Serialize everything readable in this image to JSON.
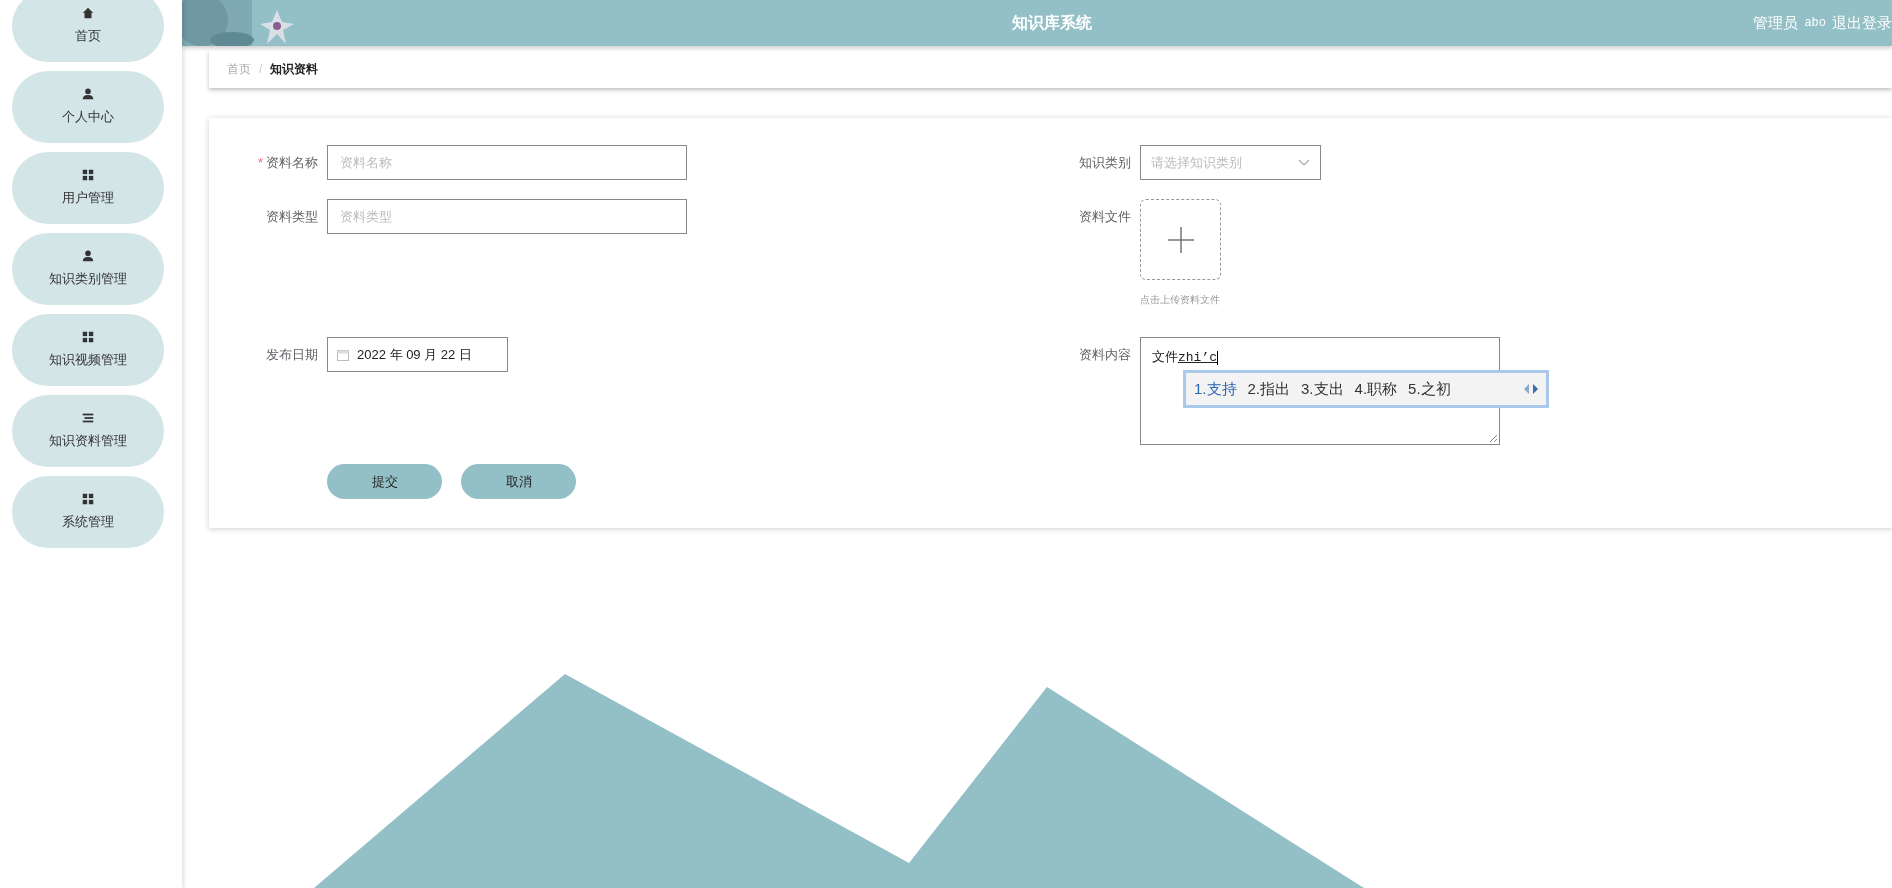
{
  "sidebar": {
    "items": [
      {
        "label": "首页",
        "kind": "home",
        "selected": false
      },
      {
        "label": "个人中心",
        "kind": "user",
        "selected": false
      },
      {
        "label": "用户管理",
        "kind": "grid",
        "selected": false
      },
      {
        "label": "知识类别管理",
        "kind": "user",
        "selected": false
      },
      {
        "label": "知识视频管理",
        "kind": "grid",
        "selected": false
      },
      {
        "label": "知识资料管理",
        "kind": "list",
        "selected": false
      },
      {
        "label": "系统管理",
        "kind": "grid",
        "selected": false
      }
    ]
  },
  "header": {
    "title": "知识库系统",
    "role": "管理员",
    "username": "abo",
    "logout": "退出登录"
  },
  "breadcrumb": {
    "separator": "/",
    "items": [
      {
        "label": "首页",
        "current": false
      },
      {
        "label": "知识资料",
        "current": true
      }
    ]
  },
  "form": {
    "name": {
      "label": "资料名称",
      "required_mark": "*",
      "placeholder": "资料名称"
    },
    "type": {
      "label": "资料类型",
      "placeholder": "资料类型"
    },
    "date": {
      "label": "发布日期",
      "value": "2022 年 09 月 22 日"
    },
    "category": {
      "label": "知识类别",
      "placeholder": "请选择知识类别"
    },
    "file": {
      "label": "资料文件",
      "hint": "点击上传资料文件"
    },
    "content": {
      "label": "资料内容",
      "value": "文件",
      "composition": "zhi’c"
    },
    "buttons": [
      "提交",
      "取消"
    ]
  },
  "ime": {
    "candidates": [
      {
        "text": "1.支持",
        "selected": true
      },
      {
        "text": "2.指出",
        "selected": false
      },
      {
        "text": "3.支出",
        "selected": false
      },
      {
        "text": "4.职称",
        "selected": false
      },
      {
        "text": "5.之初",
        "selected": false
      }
    ]
  }
}
